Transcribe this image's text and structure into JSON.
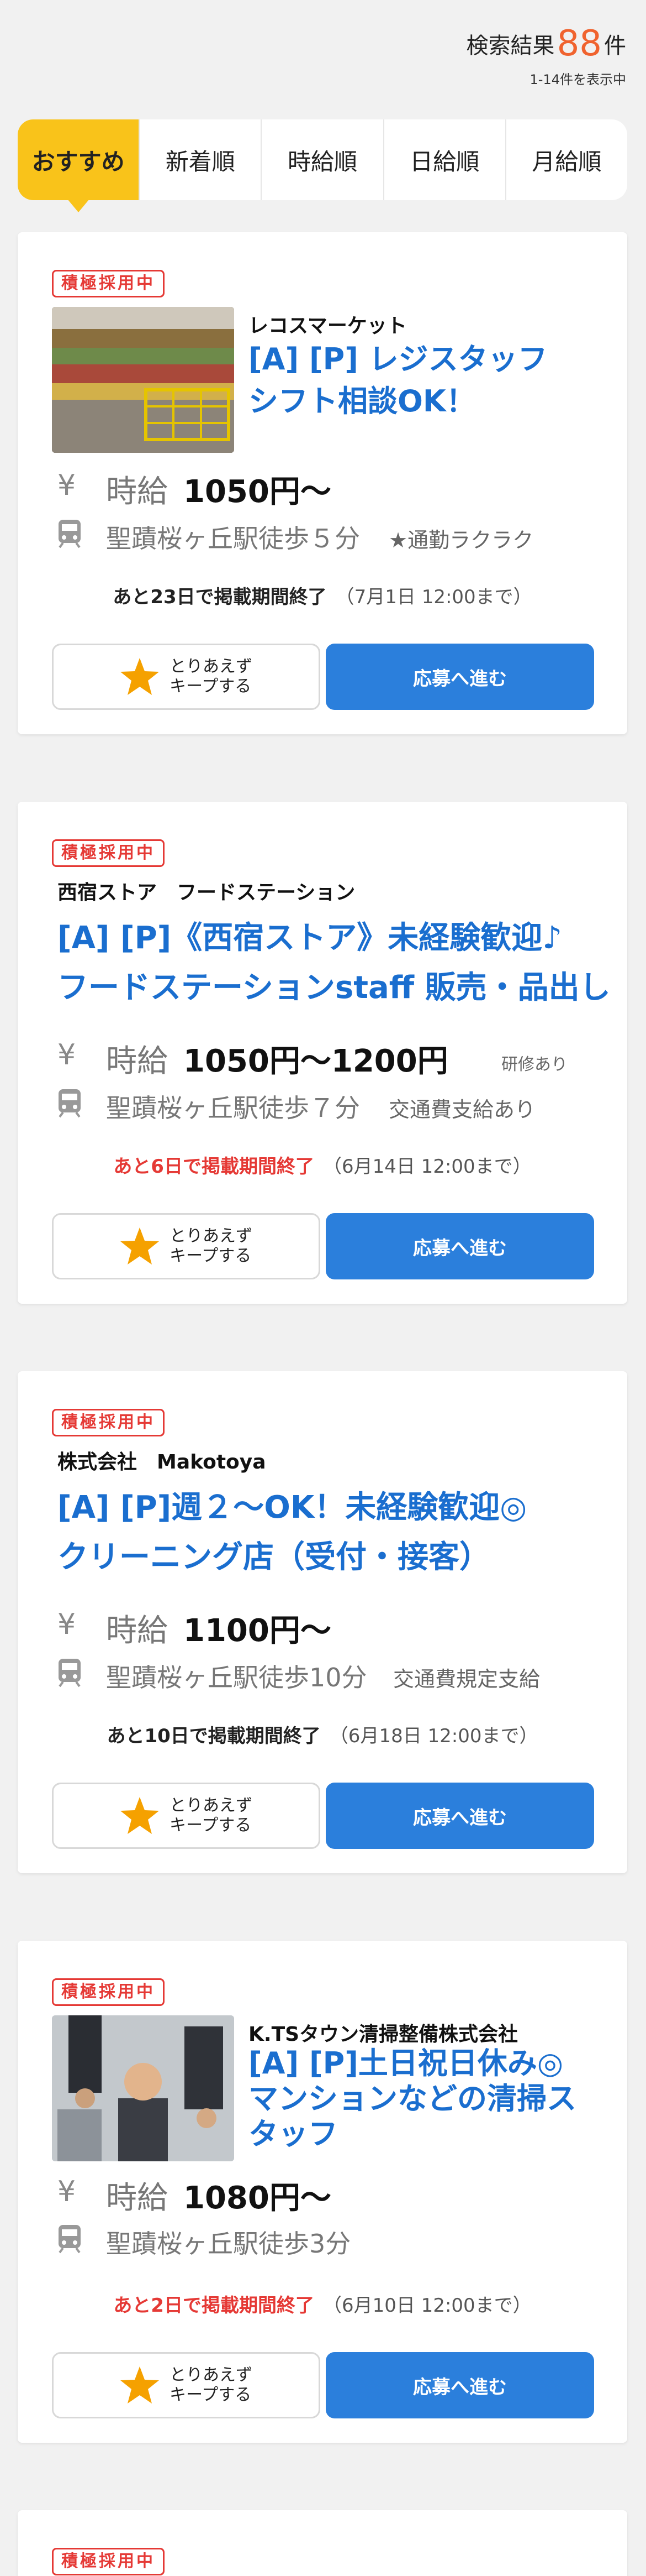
{
  "header": {
    "result_prefix": "検索結果",
    "result_count": "88",
    "result_suffix": "件",
    "result_range": "1-14件を表示中"
  },
  "tabs": [
    {
      "label": "おすすめ",
      "active": true
    },
    {
      "label": "新着順",
      "active": false
    },
    {
      "label": "時給順",
      "active": false
    },
    {
      "label": "日給順",
      "active": false
    },
    {
      "label": "月給順",
      "active": false
    }
  ],
  "colors": {
    "accent_yellow": "#f9c31a",
    "link_blue": "#1a6ecf",
    "button_blue": "#2b7fdc",
    "badge_red": "#e53935",
    "count_orange": "#f0632f",
    "star_orange": "#f5a100"
  },
  "icons": {
    "wage": "yen-icon",
    "access": "train-icon",
    "keep": "star-icon"
  },
  "jobs": [
    {
      "badge": "積極採用中",
      "company": "レコスマーケット",
      "title_line1": "[A] [P] レジスタッフ",
      "title_line2": "シフト相談OK！",
      "wage_label": "時給",
      "wage_value": "1050円〜",
      "wage_note": "",
      "station": "聖蹟桜ヶ丘駅徒歩５分",
      "perk": "★通勤ラクラク",
      "deadline_main": "あと23日で掲載期間終了",
      "deadline_date": "（7月1日 12:00まで）",
      "deadline_urgent": false,
      "keep_label": "とりあえず\nキープする",
      "apply_label": "応募へ進む"
    },
    {
      "badge": "積極採用中",
      "company": "西宿ストア　フードステーション",
      "title_line1": "[A] [P]《西宿ストア》未経験歓迎♪",
      "title_line2": "フードステーションstaff 販売・品出し",
      "wage_label": "時給",
      "wage_value": "1050円〜1200円",
      "wage_note": "研修あり",
      "station": "聖蹟桜ヶ丘駅徒歩７分",
      "perk": "交通費支給あり",
      "deadline_main": "あと6日で掲載期間終了",
      "deadline_date": "（6月14日 12:00まで）",
      "deadline_urgent": true,
      "keep_label": "とりあえず\nキープする",
      "apply_label": "応募へ進む"
    },
    {
      "badge": "積極採用中",
      "company": "株式会社　Makotoya",
      "title_line1": "[A] [P]週２〜OK！未経験歓迎◎",
      "title_line2": "クリーニング店（受付・接客）",
      "wage_label": "時給",
      "wage_value": "1100円〜",
      "wage_note": "",
      "station": "聖蹟桜ヶ丘駅徒歩10分",
      "perk": "交通費規定支給",
      "deadline_main": "あと10日で掲載期間終了",
      "deadline_date": "（6月18日 12:00まで）",
      "deadline_urgent": false,
      "keep_label": "とりあえず\nキープする",
      "apply_label": "応募へ進む"
    },
    {
      "badge": "積極採用中",
      "company": "K.TSタウン清掃整備株式会社",
      "title_line1": "[A] [P]土日祝日休み◎",
      "title_line2": "マンションなどの清掃ス",
      "title_line3": "タッフ",
      "wage_label": "時給",
      "wage_value": "1080円〜",
      "wage_note": "",
      "station": "聖蹟桜ヶ丘駅徒歩3分",
      "perk": "",
      "deadline_main": "あと2日で掲載期間終了",
      "deadline_date": "（6月10日 12:00まで）",
      "deadline_urgent": true,
      "keep_label": "とりあえず\nキープする",
      "apply_label": "応募へ進む"
    },
    {
      "badge": "積極採用中"
    }
  ]
}
